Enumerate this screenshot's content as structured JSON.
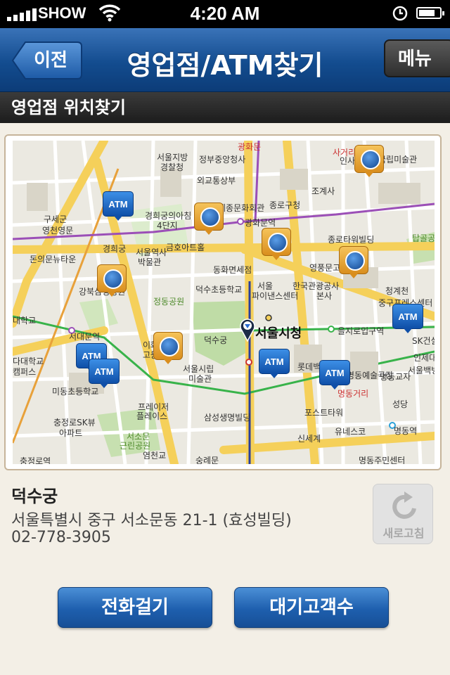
{
  "status_bar": {
    "carrier": "SHOW",
    "time": "4:20 AM",
    "battery_level": 0.8
  },
  "navbar": {
    "back_label": "이전",
    "title": "영업점/ATM찾기",
    "menu_label": "메뉴"
  },
  "section_title": "영업점 위치찾기",
  "map": {
    "labels": [
      {
        "text": "광화문",
        "cls": "r"
      },
      {
        "text": "서울지방",
        "cls": ""
      },
      {
        "text": "경찰청",
        "cls": ""
      },
      {
        "text": "정부중앙청사",
        "cls": ""
      },
      {
        "text": "외교통상부",
        "cls": ""
      },
      {
        "text": "세종문화회관",
        "cls": ""
      },
      {
        "text": "광화문역",
        "cls": ""
      },
      {
        "text": "종로구청",
        "cls": ""
      },
      {
        "text": "조계사",
        "cls": ""
      },
      {
        "text": "서울역사",
        "cls": ""
      },
      {
        "text": "박물관",
        "cls": ""
      },
      {
        "text": "경희궁의아침",
        "cls": ""
      },
      {
        "text": "4단지",
        "cls": ""
      },
      {
        "text": "금호아트홀",
        "cls": ""
      },
      {
        "text": "경희궁",
        "cls": ""
      },
      {
        "text": "구세군",
        "cls": ""
      },
      {
        "text": "영천영문",
        "cls": ""
      },
      {
        "text": "돈의문뉴타운",
        "cls": ""
      },
      {
        "text": "동화면세점",
        "cls": ""
      },
      {
        "text": "종로타워빌딩",
        "cls": ""
      },
      {
        "text": "영풍문고",
        "cls": ""
      },
      {
        "text": "한국관광공사",
        "cls": ""
      },
      {
        "text": "본사",
        "cls": ""
      },
      {
        "text": "서울",
        "cls": ""
      },
      {
        "text": "파이낸스센터",
        "cls": ""
      },
      {
        "text": "덕수초등학교",
        "cls": ""
      },
      {
        "text": "정동공원",
        "cls": "g"
      },
      {
        "text": "덕수궁",
        "cls": ""
      },
      {
        "text": "서울시청",
        "cls": "big"
      },
      {
        "text": "을지로입구역",
        "cls": ""
      },
      {
        "text": "청계천",
        "cls": ""
      },
      {
        "text": "중구프레스센터",
        "cls": ""
      },
      {
        "text": "서대문역",
        "cls": ""
      },
      {
        "text": "강북삼성병원",
        "cls": ""
      },
      {
        "text": "서울시립",
        "cls": ""
      },
      {
        "text": "미술관",
        "cls": ""
      },
      {
        "text": "롯데백화점",
        "cls": ""
      },
      {
        "text": "명동예술극장",
        "cls": ""
      },
      {
        "text": "명동거리",
        "cls": "r"
      },
      {
        "text": "명동교자",
        "cls": ""
      },
      {
        "text": "성당",
        "cls": ""
      },
      {
        "text": "SK건설",
        "cls": ""
      },
      {
        "text": "인제대",
        "cls": ""
      },
      {
        "text": "서울백병원",
        "cls": ""
      },
      {
        "text": "프레이저",
        "cls": ""
      },
      {
        "text": "플레이스",
        "cls": ""
      },
      {
        "text": "미동초등학교",
        "cls": ""
      },
      {
        "text": "충정로SK뷰",
        "cls": ""
      },
      {
        "text": "아파트",
        "cls": ""
      },
      {
        "text": "서소문",
        "cls": "g"
      },
      {
        "text": "근린공원",
        "cls": "g"
      },
      {
        "text": "삼성생명빌딩",
        "cls": ""
      },
      {
        "text": "포스트타워",
        "cls": ""
      },
      {
        "text": "신세계",
        "cls": ""
      },
      {
        "text": "유네스코",
        "cls": ""
      },
      {
        "text": "명동역",
        "cls": ""
      },
      {
        "text": "명동주민센터",
        "cls": ""
      },
      {
        "text": "숭례문",
        "cls": ""
      },
      {
        "text": "염천교",
        "cls": ""
      },
      {
        "text": "충정로역",
        "cls": ""
      },
      {
        "text": "대학교",
        "cls": ""
      },
      {
        "text": "탑골공원",
        "cls": "g"
      },
      {
        "text": "인사동",
        "cls": ""
      },
      {
        "text": "사거리",
        "cls": "r"
      },
      {
        "text": "국립미술관",
        "cls": ""
      },
      {
        "text": "이화여자",
        "cls": ""
      },
      {
        "text": "고등학교",
        "cls": ""
      },
      {
        "text": "다대학교",
        "cls": ""
      },
      {
        "text": "캠퍼스",
        "cls": ""
      }
    ],
    "markers": [
      {
        "kind": "atm",
        "label": "ATM"
      },
      {
        "kind": "atm",
        "label": "ATM"
      },
      {
        "kind": "atm",
        "label": "ATM"
      },
      {
        "kind": "atm",
        "label": "ATM"
      },
      {
        "kind": "atm",
        "label": "ATM"
      },
      {
        "kind": "atm",
        "label": "ATM"
      },
      {
        "kind": "bank"
      },
      {
        "kind": "bank"
      },
      {
        "kind": "bank"
      },
      {
        "kind": "bank"
      },
      {
        "kind": "bank"
      },
      {
        "kind": "bank"
      }
    ]
  },
  "branch": {
    "name": "덕수궁",
    "address": "서울특별시 중구 서소문동 21-1 (효성빌딩)",
    "phone": "02-778-3905"
  },
  "refresh_label": "새로고침",
  "buttons": {
    "call": "전화걸기",
    "queue": "대기고객수"
  }
}
